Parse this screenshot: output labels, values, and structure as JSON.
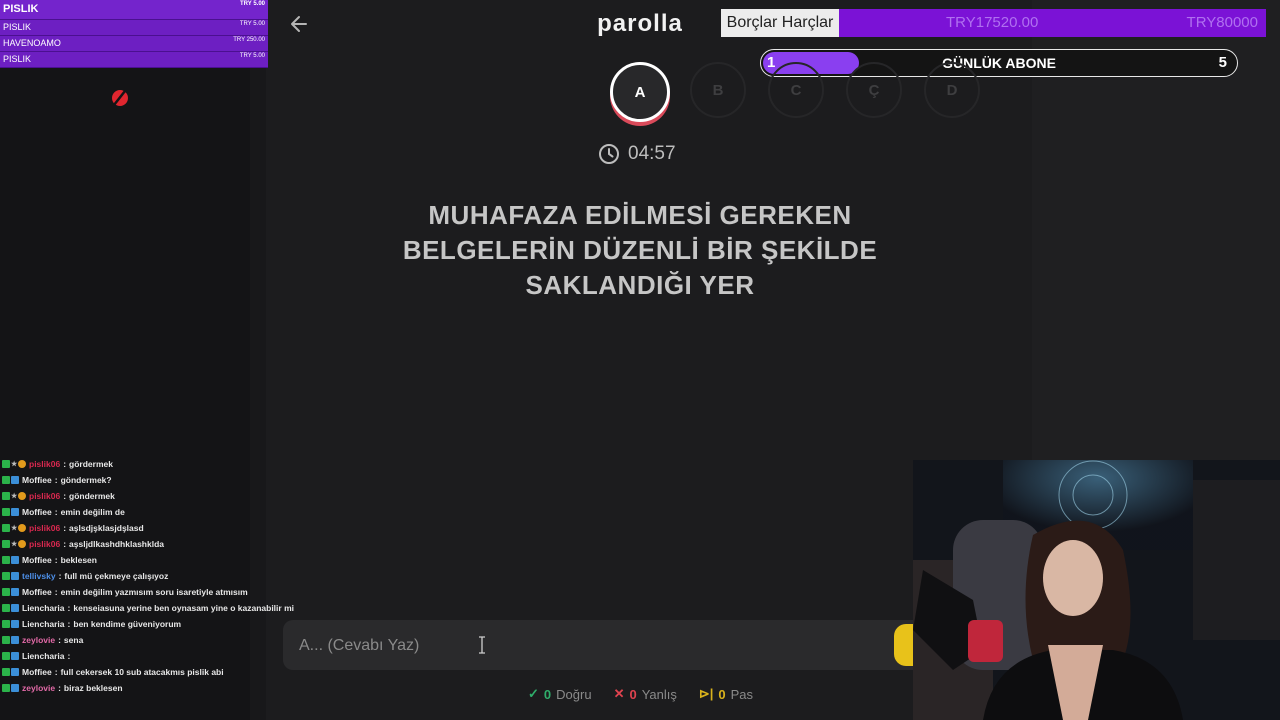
{
  "donations": [
    {
      "name": "PISLIK",
      "amount": "TRY 5.00"
    },
    {
      "name": "PISLIK",
      "amount": "TRY 5.00"
    },
    {
      "name": "HAVENOAMO",
      "amount": "TRY 250.00"
    },
    {
      "name": "PISLIK",
      "amount": "TRY 5.00"
    }
  ],
  "header": {
    "brand": "parolla"
  },
  "goal": {
    "label": "Borçlar Harçlar",
    "current": "TRY17520.00",
    "target": "TRY80000",
    "progress": 0.219
  },
  "sub_goal": {
    "start": "1",
    "label": "GÜNLÜK ABONE",
    "end": "5",
    "progress": 0.2
  },
  "letters": [
    "A",
    "B",
    "C",
    "Ç",
    "D"
  ],
  "active_letter": "A",
  "timer": "04:57",
  "question": "MUHAFAZA EDİLMESİ GEREKEN BELGELERİN DÜZENLİ BİR ŞEKİLDE SAKLANDIĞI YER",
  "answer": {
    "placeholder": "A... (Cevabı Yaz)",
    "value": ""
  },
  "stats": {
    "correct_count": "0",
    "correct_label": "Doğru",
    "wrong_count": "0",
    "wrong_label": "Yanlış",
    "pass_count": "0",
    "pass_label": "Pas"
  },
  "chat": [
    {
      "user": "pislik06",
      "message": "gördermek",
      "color": "#d9284f"
    },
    {
      "user": "Moffiee",
      "message": "göndermek?",
      "color": "#e8e8e8"
    },
    {
      "user": "pislik06",
      "message": "göndermek",
      "color": "#d9284f"
    },
    {
      "user": "Moffiee",
      "message": "emin değilim de",
      "color": "#e8e8e8"
    },
    {
      "user": "pislik06",
      "message": "aşlsdjşklasjdşlasd",
      "color": "#d9284f"
    },
    {
      "user": "pislik06",
      "message": "aşsljdlkashdhklashklda",
      "color": "#d9284f"
    },
    {
      "user": "Moffiee",
      "message": "beklesen",
      "color": "#e8e8e8"
    },
    {
      "user": "tellivsky",
      "message": "full mü çekmeye çalışıyoz",
      "color": "#4d8fe8"
    },
    {
      "user": "Moffiee",
      "message": "emin değilim yazmısım soru isaretiyle atmısım",
      "color": "#e8e8e8"
    },
    {
      "user": "Liencharia",
      "message": "kenseiasuna yerine ben oynasam yine o kazanabilir mi",
      "color": "#e8e8e8"
    },
    {
      "user": "Liencharia",
      "message": "ben kendime güveniyorum",
      "color": "#e8e8e8"
    },
    {
      "user": "zeylovie",
      "message": "sena",
      "color": "#e36aa8"
    },
    {
      "user": "Liencharia",
      "message": "",
      "color": "#e8e8e8"
    },
    {
      "user": "Moffiee",
      "message": "full cekersek 10 sub atacakmıs pislik abi",
      "color": "#e8e8e8"
    },
    {
      "user": "zeylovie",
      "message": "biraz beklesen",
      "color": "#e36aa8"
    }
  ]
}
